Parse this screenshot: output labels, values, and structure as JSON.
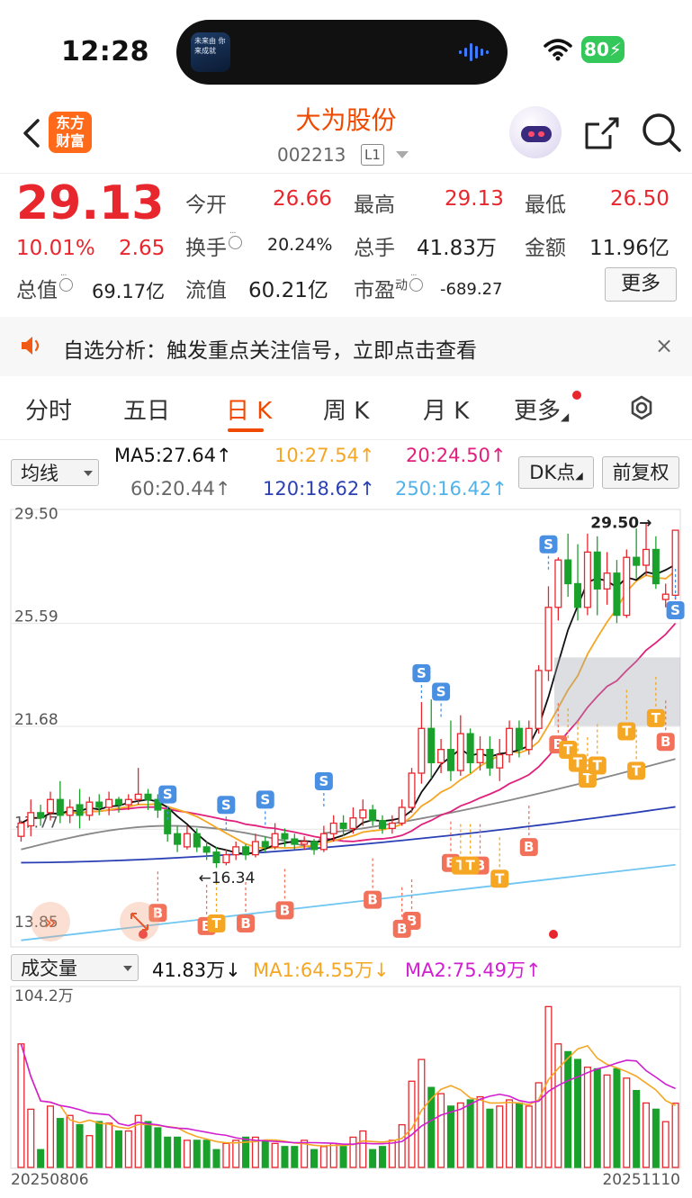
{
  "status_bar": {
    "time": "12:28",
    "battery": "80"
  },
  "island": {
    "thumb_text": "未来由\n你来成就"
  },
  "header": {
    "logo_line1": "东方",
    "logo_line2": "财富",
    "title": "大为股份",
    "code": "002213",
    "badge": "L1"
  },
  "quote": {
    "price": "29.13",
    "change_pct": "10.01%",
    "change": "2.65",
    "labels": {
      "open": "今开",
      "high": "最高",
      "low": "最低",
      "turnover": "换手",
      "volume": "总手",
      "amount": "金额",
      "mkt_cap": "总值",
      "float_cap": "流值",
      "pe": "市盈",
      "pe_sup": "动"
    },
    "open": "26.66",
    "high": "29.13",
    "low": "26.50",
    "turnover": "20.24%",
    "volume": "41.83万",
    "amount": "11.96亿",
    "mkt_cap": "69.17亿",
    "float_cap": "60.21亿",
    "pe": "-689.27",
    "more": "更多"
  },
  "notice": {
    "text": "自选分析：触发重点关注信号，立即点击查看",
    "close": "×"
  },
  "tabs": [
    {
      "label": "分时"
    },
    {
      "label": "五日"
    },
    {
      "label": "日 K"
    },
    {
      "label": "周 K"
    },
    {
      "label": "月 K"
    },
    {
      "label": "更多"
    }
  ],
  "ma_bar": {
    "select": "均线",
    "ma5": "MA5:27.64↑",
    "ma10": "10:27.54↑",
    "ma20": "20:24.50↑",
    "ma60": "60:20.44↑",
    "ma120": "120:18.62↑",
    "ma250": "250:16.42↑",
    "dk": "DK点",
    "adjust": "前复权"
  },
  "colors": {
    "up": "#e8262d",
    "down": "#1aa12c",
    "ma5": "#111111",
    "ma10": "#f5a623",
    "ma20": "#e0207c",
    "ma60": "#888888",
    "ma120": "#2b3fb5",
    "ma250": "#6fc6f2",
    "accent": "#f04a00"
  },
  "chart_data": [
    {
      "type": "candlestick",
      "y_ticks": [
        "29.50",
        "25.59",
        "21.68",
        "17.77",
        "13.85"
      ],
      "annotations": {
        "max": "29.50",
        "min": "16.34"
      },
      "signals": {
        "buy": "B",
        "sell": "S",
        "t": "T"
      },
      "candles": [
        [
          17.5,
          18.0,
          17.3,
          18.1
        ],
        [
          17.9,
          18.4,
          17.5,
          18.9
        ],
        [
          18.4,
          18.2,
          17.9,
          18.7
        ],
        [
          18.4,
          18.9,
          18.1,
          19.2
        ],
        [
          18.9,
          18.3,
          18.0,
          19.6
        ],
        [
          18.3,
          18.6,
          18.0,
          18.9
        ],
        [
          18.7,
          18.3,
          17.8,
          19.3
        ],
        [
          18.3,
          18.8,
          18.1,
          19.0
        ],
        [
          18.8,
          18.6,
          18.3,
          19.1
        ],
        [
          18.6,
          18.9,
          18.3,
          19.2
        ],
        [
          18.9,
          18.7,
          18.4,
          19.0
        ],
        [
          18.7,
          18.9,
          18.5,
          19.1
        ],
        [
          18.9,
          19.1,
          18.7,
          20.1
        ],
        [
          19.1,
          18.9,
          18.5,
          19.3
        ],
        [
          18.9,
          18.5,
          18.2,
          19.1
        ],
        [
          18.5,
          17.6,
          17.3,
          18.6
        ],
        [
          17.6,
          17.2,
          16.9,
          17.9
        ],
        [
          17.1,
          17.6,
          17.0,
          17.9
        ],
        [
          17.6,
          17.1,
          16.9,
          17.8
        ],
        [
          17.1,
          16.9,
          16.6,
          17.3
        ],
        [
          16.9,
          16.5,
          16.3,
          17.1
        ],
        [
          16.5,
          16.8,
          16.4,
          17.0
        ],
        [
          16.8,
          17.1,
          16.6,
          17.3
        ],
        [
          17.1,
          16.8,
          16.6,
          17.2
        ],
        [
          16.8,
          17.3,
          16.7,
          17.6
        ],
        [
          17.3,
          17.1,
          16.9,
          17.5
        ],
        [
          17.1,
          17.6,
          17.0,
          18.0
        ],
        [
          17.6,
          17.4,
          17.1,
          17.8
        ],
        [
          17.4,
          17.2,
          17.0,
          17.6
        ],
        [
          17.2,
          17.3,
          17.0,
          17.5
        ],
        [
          17.3,
          17.0,
          16.8,
          17.4
        ],
        [
          17.0,
          17.6,
          16.9,
          17.9
        ],
        [
          17.6,
          18.0,
          17.3,
          18.3
        ],
        [
          18.0,
          17.8,
          17.5,
          18.3
        ],
        [
          17.8,
          18.2,
          17.6,
          18.6
        ],
        [
          18.2,
          18.5,
          17.9,
          18.9
        ],
        [
          18.5,
          18.1,
          17.9,
          18.7
        ],
        [
          18.1,
          17.8,
          17.6,
          18.3
        ],
        [
          17.8,
          18.0,
          17.6,
          18.3
        ],
        [
          18.0,
          18.6,
          17.9,
          18.9
        ],
        [
          18.6,
          19.9,
          18.4,
          20.1
        ],
        [
          19.9,
          21.6,
          19.5,
          22.6
        ],
        [
          21.6,
          20.3,
          19.7,
          22.7
        ],
        [
          20.3,
          20.8,
          19.9,
          21.2
        ],
        [
          20.8,
          20.0,
          19.6,
          21.9
        ],
        [
          20.0,
          21.4,
          19.8,
          22.1
        ],
        [
          21.4,
          20.3,
          19.9,
          21.6
        ],
        [
          20.3,
          20.8,
          20.0,
          21.3
        ],
        [
          20.8,
          20.1,
          19.8,
          21.3
        ],
        [
          20.1,
          20.6,
          19.6,
          21.2
        ],
        [
          20.6,
          21.6,
          20.3,
          21.9
        ],
        [
          21.6,
          20.8,
          20.5,
          21.9
        ],
        [
          20.8,
          21.6,
          20.6,
          21.9
        ],
        [
          21.6,
          23.8,
          21.4,
          24.0
        ],
        [
          23.8,
          26.2,
          23.4,
          27.0
        ],
        [
          26.2,
          28.0,
          25.7,
          28.1
        ],
        [
          28.0,
          27.1,
          26.6,
          29.0
        ],
        [
          27.1,
          26.2,
          25.7,
          28.6
        ],
        [
          26.2,
          28.3,
          25.9,
          29.0
        ],
        [
          28.3,
          26.9,
          25.9,
          28.9
        ],
        [
          26.9,
          27.5,
          26.3,
          28.3
        ],
        [
          27.5,
          25.9,
          25.6,
          28.0
        ],
        [
          25.9,
          28.1,
          25.8,
          28.4
        ],
        [
          28.1,
          27.8,
          27.3,
          29.2
        ],
        [
          27.8,
          28.4,
          27.4,
          29.4
        ],
        [
          28.4,
          27.1,
          26.9,
          28.9
        ],
        [
          26.5,
          26.7,
          26.2,
          27.1
        ],
        [
          26.66,
          29.13,
          26.5,
          29.13
        ]
      ]
    },
    {
      "type": "bar",
      "name": "成交量",
      "select": "成交量",
      "current": "41.83万↓",
      "ma1": "MA1:64.55万↓",
      "ma2": "MA2:75.49万↑",
      "ymax_label": "104.2万",
      "x_start": "20250806",
      "x_end": "20251110"
    }
  ]
}
